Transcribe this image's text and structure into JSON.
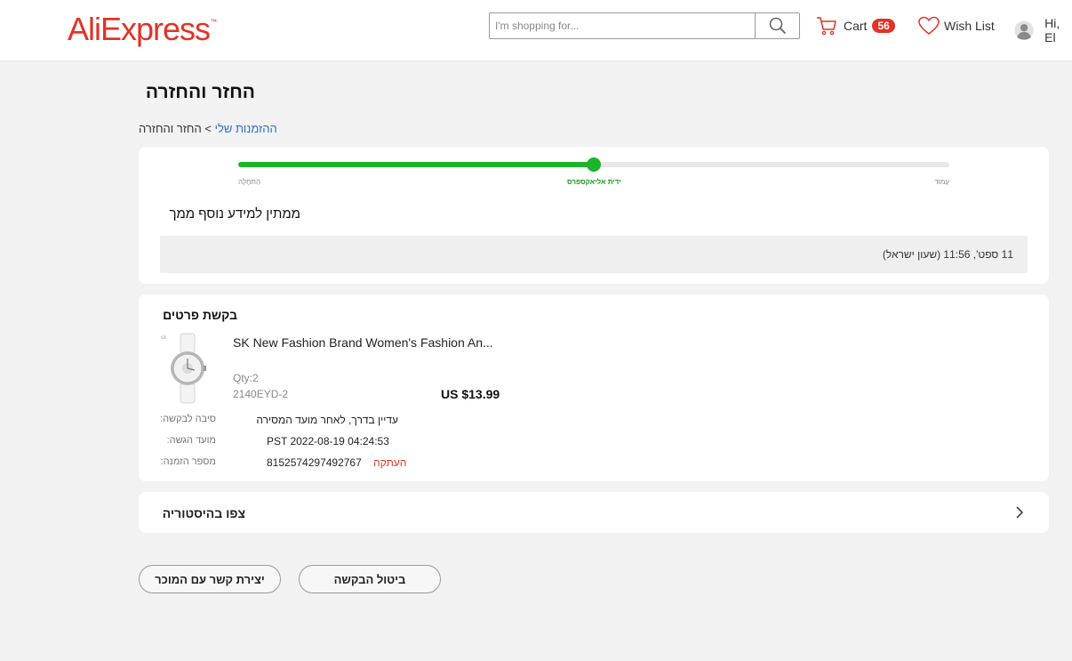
{
  "header": {
    "logo": "AliExpress",
    "search_placeholder": "I'm shopping for...",
    "cart_label": "Cart",
    "cart_count": "56",
    "wishlist_label": "Wish List",
    "user_greeting": "Hi, El"
  },
  "page": {
    "title": "החזר והחזרה",
    "breadcrumb": {
      "link": "ההזמנות שלי",
      "separator": ">",
      "current": "החזר והחזרה"
    }
  },
  "progress": {
    "steps": [
      "הַתחָלָה",
      "ידית אליאקספרס",
      "עָמוּד"
    ],
    "current_step": 1,
    "fraction": 0.5,
    "status_text": "ממתין למידע נוסף ממך",
    "status_time": "11 ספט', 11:56 (שעון ישראל)"
  },
  "details": {
    "section_title": "בקשת פרטים",
    "product": {
      "name": "SK New Fashion Brand Women's Fashion An...",
      "qty": "Qty:2",
      "sku": "2140EYD-2",
      "price": "US $13.99"
    },
    "rows": [
      {
        "label": "סיבה לבקשה:",
        "value": "עדיין בדרך, לאחר מועד המסירה"
      },
      {
        "label": "מועד הגשה:",
        "value": "PST 2022-08-19 04:24:53"
      },
      {
        "label": "מספר הזמנה:",
        "value": "8152574297492767"
      }
    ],
    "copy_label": "העתקה"
  },
  "history": {
    "label": "צפו בהיסטוריה"
  },
  "actions": {
    "contact_seller": "יצירת קשר עם המוכר",
    "cancel_request": "ביטול הבקשה"
  },
  "colors": {
    "brand": "#e43225",
    "progress": "#1db32a",
    "link": "#2b6fd5"
  }
}
